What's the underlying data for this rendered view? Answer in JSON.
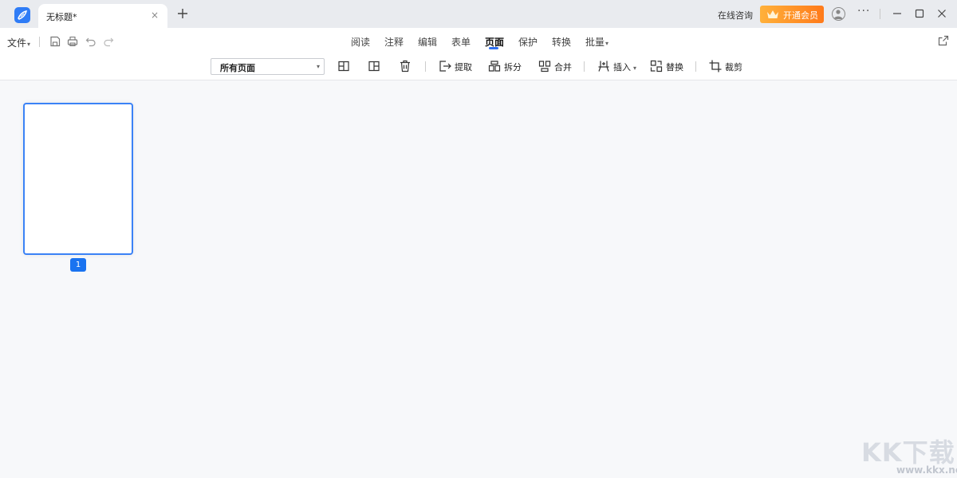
{
  "titlebar": {
    "tab_title": "无标题*",
    "tab_close": "×",
    "consult": "在线咨询",
    "vip": "开通会员",
    "more": "···"
  },
  "menu": {
    "file": "文件",
    "nav_tabs": [
      "阅读",
      "注释",
      "编辑",
      "表单",
      "页面",
      "保护",
      "转换",
      "批量"
    ],
    "active_tab": "页面"
  },
  "toolbar": {
    "page_select": "所有页面",
    "extract": "提取",
    "split": "拆分",
    "merge": "合并",
    "insert": "插入",
    "replace": "替换",
    "crop": "裁剪"
  },
  "canvas": {
    "page_number": "1"
  },
  "watermark": {
    "text": "KK下载",
    "url": "www.kkx.net"
  },
  "colors": {
    "accent": "#2f6ff0",
    "vip": "#ff8c1a",
    "page_border": "#3b82f6"
  }
}
